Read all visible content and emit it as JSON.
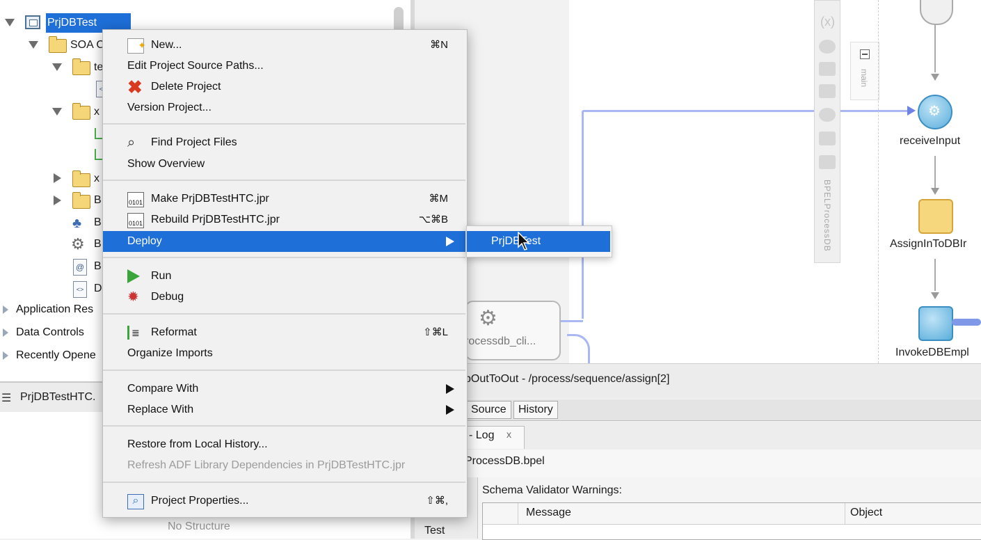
{
  "tree": {
    "project_label": "PrjDBTest",
    "soa_label": "SOA C",
    "folder_t_label": "te",
    "folder_x1_label": "x",
    "folder_x2_label": "x",
    "folder_b_label": "B",
    "item_b1": "B",
    "item_b2": "B",
    "item_b3": "B",
    "item_d": "D",
    "panels": [
      "Application Res",
      "Data Controls",
      "Recently Opene"
    ]
  },
  "structure": {
    "tab_label": "PrjDBTestHTC.",
    "empty_text": "No Structure"
  },
  "context_menu": {
    "new": {
      "label": "New...",
      "shortcut": "⌘N"
    },
    "edit_paths": {
      "label": "Edit Project Source Paths..."
    },
    "delete": {
      "label": "Delete Project"
    },
    "version": {
      "label": "Version Project..."
    },
    "find_files": {
      "label": "Find Project Files"
    },
    "show_overview": {
      "label": "Show Overview"
    },
    "make": {
      "label": "Make PrjDBTestHTC.jpr",
      "shortcut": "⌘M"
    },
    "rebuild": {
      "label": "Rebuild PrjDBTestHTC.jpr",
      "shortcut": "⌥⌘B"
    },
    "deploy": {
      "label": "Deploy"
    },
    "run": {
      "label": "Run"
    },
    "debug": {
      "label": "Debug"
    },
    "reformat": {
      "label": "Reformat",
      "shortcut": "⇧⌘L"
    },
    "organize": {
      "label": "Organize Imports"
    },
    "compare": {
      "label": "Compare With"
    },
    "replace": {
      "label": "Replace With"
    },
    "restore": {
      "label": "Restore from Local History..."
    },
    "refresh_adf": {
      "label": "Refresh ADF Library Dependencies in PrjDBTestHTC.jpr"
    },
    "properties": {
      "label": "Project Properties...",
      "shortcut": "⇧⌘,"
    }
  },
  "deploy_submenu": {
    "item": "PrjDBTest"
  },
  "canvas": {
    "bpel_vertical_label": "BPELProcessDB",
    "main_label": "main",
    "service_label": "rocessdb_cli...",
    "activities": [
      "receiveInput",
      "AssignInToDBIr",
      "InvokeDBEmpl"
    ]
  },
  "editor": {
    "breadcrumb": "bOutToOut - /process/sequence/assign[2]",
    "tabs": [
      "Source",
      "History"
    ],
    "log_tab": "- Log",
    "log_close": "x",
    "file_label": "ProcessDB.bpel",
    "schema_label": "Schema Validator Warnings:",
    "columns": [
      "Message",
      "Object"
    ],
    "test_label": "Test"
  },
  "colors": {
    "highlight": "#1e6fd8",
    "flow_blue": "#a9b7f2"
  }
}
